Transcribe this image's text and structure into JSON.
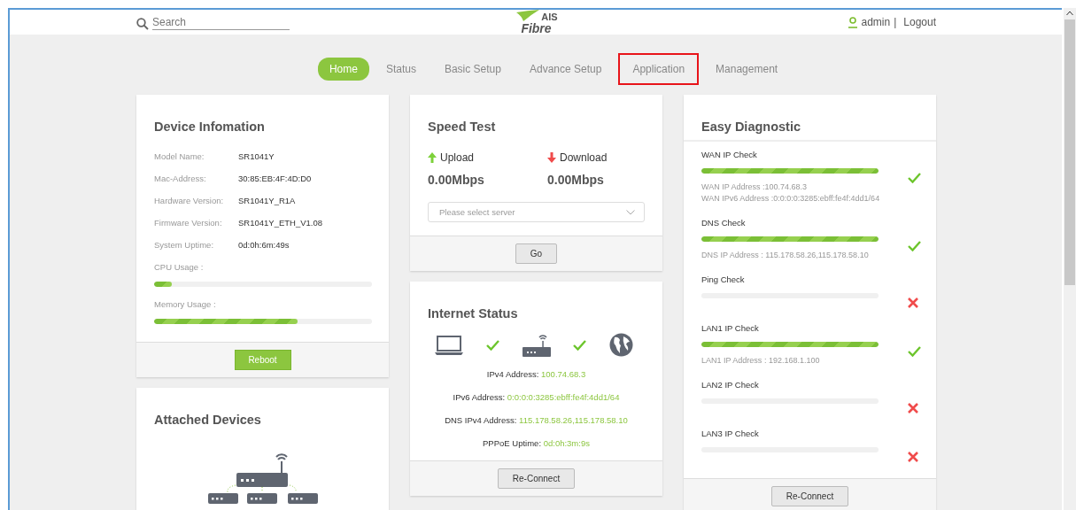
{
  "header": {
    "search": {
      "placeholder": "Search"
    },
    "logo": {
      "top": "AIS",
      "bottom": "Fibre"
    },
    "user": "admin",
    "separator": "|",
    "logout": "Logout"
  },
  "nav": [
    {
      "label": "Home",
      "selected": true,
      "highlighted": false
    },
    {
      "label": "Status",
      "selected": false,
      "highlighted": false
    },
    {
      "label": "Basic Setup",
      "selected": false,
      "highlighted": false
    },
    {
      "label": "Advance Setup",
      "selected": false,
      "highlighted": false
    },
    {
      "label": "Application",
      "selected": false,
      "highlighted": true
    },
    {
      "label": "Management",
      "selected": false,
      "highlighted": false
    }
  ],
  "device_info": {
    "title": "Device Infomation",
    "fields": [
      {
        "label": "Model Name:",
        "value": "SR1041Y"
      },
      {
        "label": "Mac-Address:",
        "value": "30:85:EB:4F:4D:D0"
      },
      {
        "label": "Hardware Version:",
        "value": "SR1041Y_R1A"
      },
      {
        "label": "Firmware Version:",
        "value": "SR1041Y_ETH_V1.08"
      },
      {
        "label": "System Uptime:",
        "value": "0d:0h:6m:49s"
      }
    ],
    "usage": [
      {
        "label": "CPU Usage :",
        "level": 0.08
      },
      {
        "label": "Memory Usage :",
        "level": 0.66
      }
    ],
    "button": "Reboot"
  },
  "attached_devices": {
    "title": "Attached Devices"
  },
  "speed_test": {
    "title": "Speed Test",
    "upload": {
      "label": "Upload",
      "value": "0.00Mbps"
    },
    "download": {
      "label": "Download",
      "value": "0.00Mbps"
    },
    "server_select": {
      "placeholder": "Please select server"
    },
    "button": "Go"
  },
  "internet_status": {
    "title": "Internet Status",
    "links": [
      {
        "ok": true
      },
      {
        "ok": true
      }
    ],
    "fields": [
      {
        "label": "IPv4 Address:",
        "value": "100.74.68.3"
      },
      {
        "label": "IPv6 Address:",
        "value": "0:0:0:0:3285:ebff:fe4f:4dd1/64"
      },
      {
        "label": "DNS IPv4 Address:",
        "value": "115.178.58.26,115.178.58.10"
      },
      {
        "label": "PPPoE Uptime:",
        "value": "0d:0h:3m:9s"
      }
    ],
    "button": "Re-Connect"
  },
  "easy_diagnostic": {
    "title": "Easy Diagnostic",
    "checks": [
      {
        "label": "WAN IP Check",
        "level": 1,
        "passed": true,
        "details": [
          "WAN IP Address :100.74.68.3",
          "WAN IPv6 Address :0:0:0:0:3285:ebff:fe4f:4dd1/64"
        ]
      },
      {
        "label": "DNS Check",
        "level": 1,
        "passed": true,
        "details": [
          "DNS IP Address : 115.178.58.26,115.178.58.10"
        ]
      },
      {
        "label": "Ping Check",
        "level": 0,
        "passed": false
      },
      {
        "label": "LAN1 IP Check",
        "level": 1,
        "passed": true,
        "details": [
          "LAN1 IP Address : 192.168.1.100"
        ]
      },
      {
        "label": "LAN2 IP Check",
        "level": 0,
        "passed": false
      },
      {
        "label": "LAN3 IP Check",
        "level": 0,
        "passed": false
      }
    ],
    "button": "Re-Connect"
  }
}
